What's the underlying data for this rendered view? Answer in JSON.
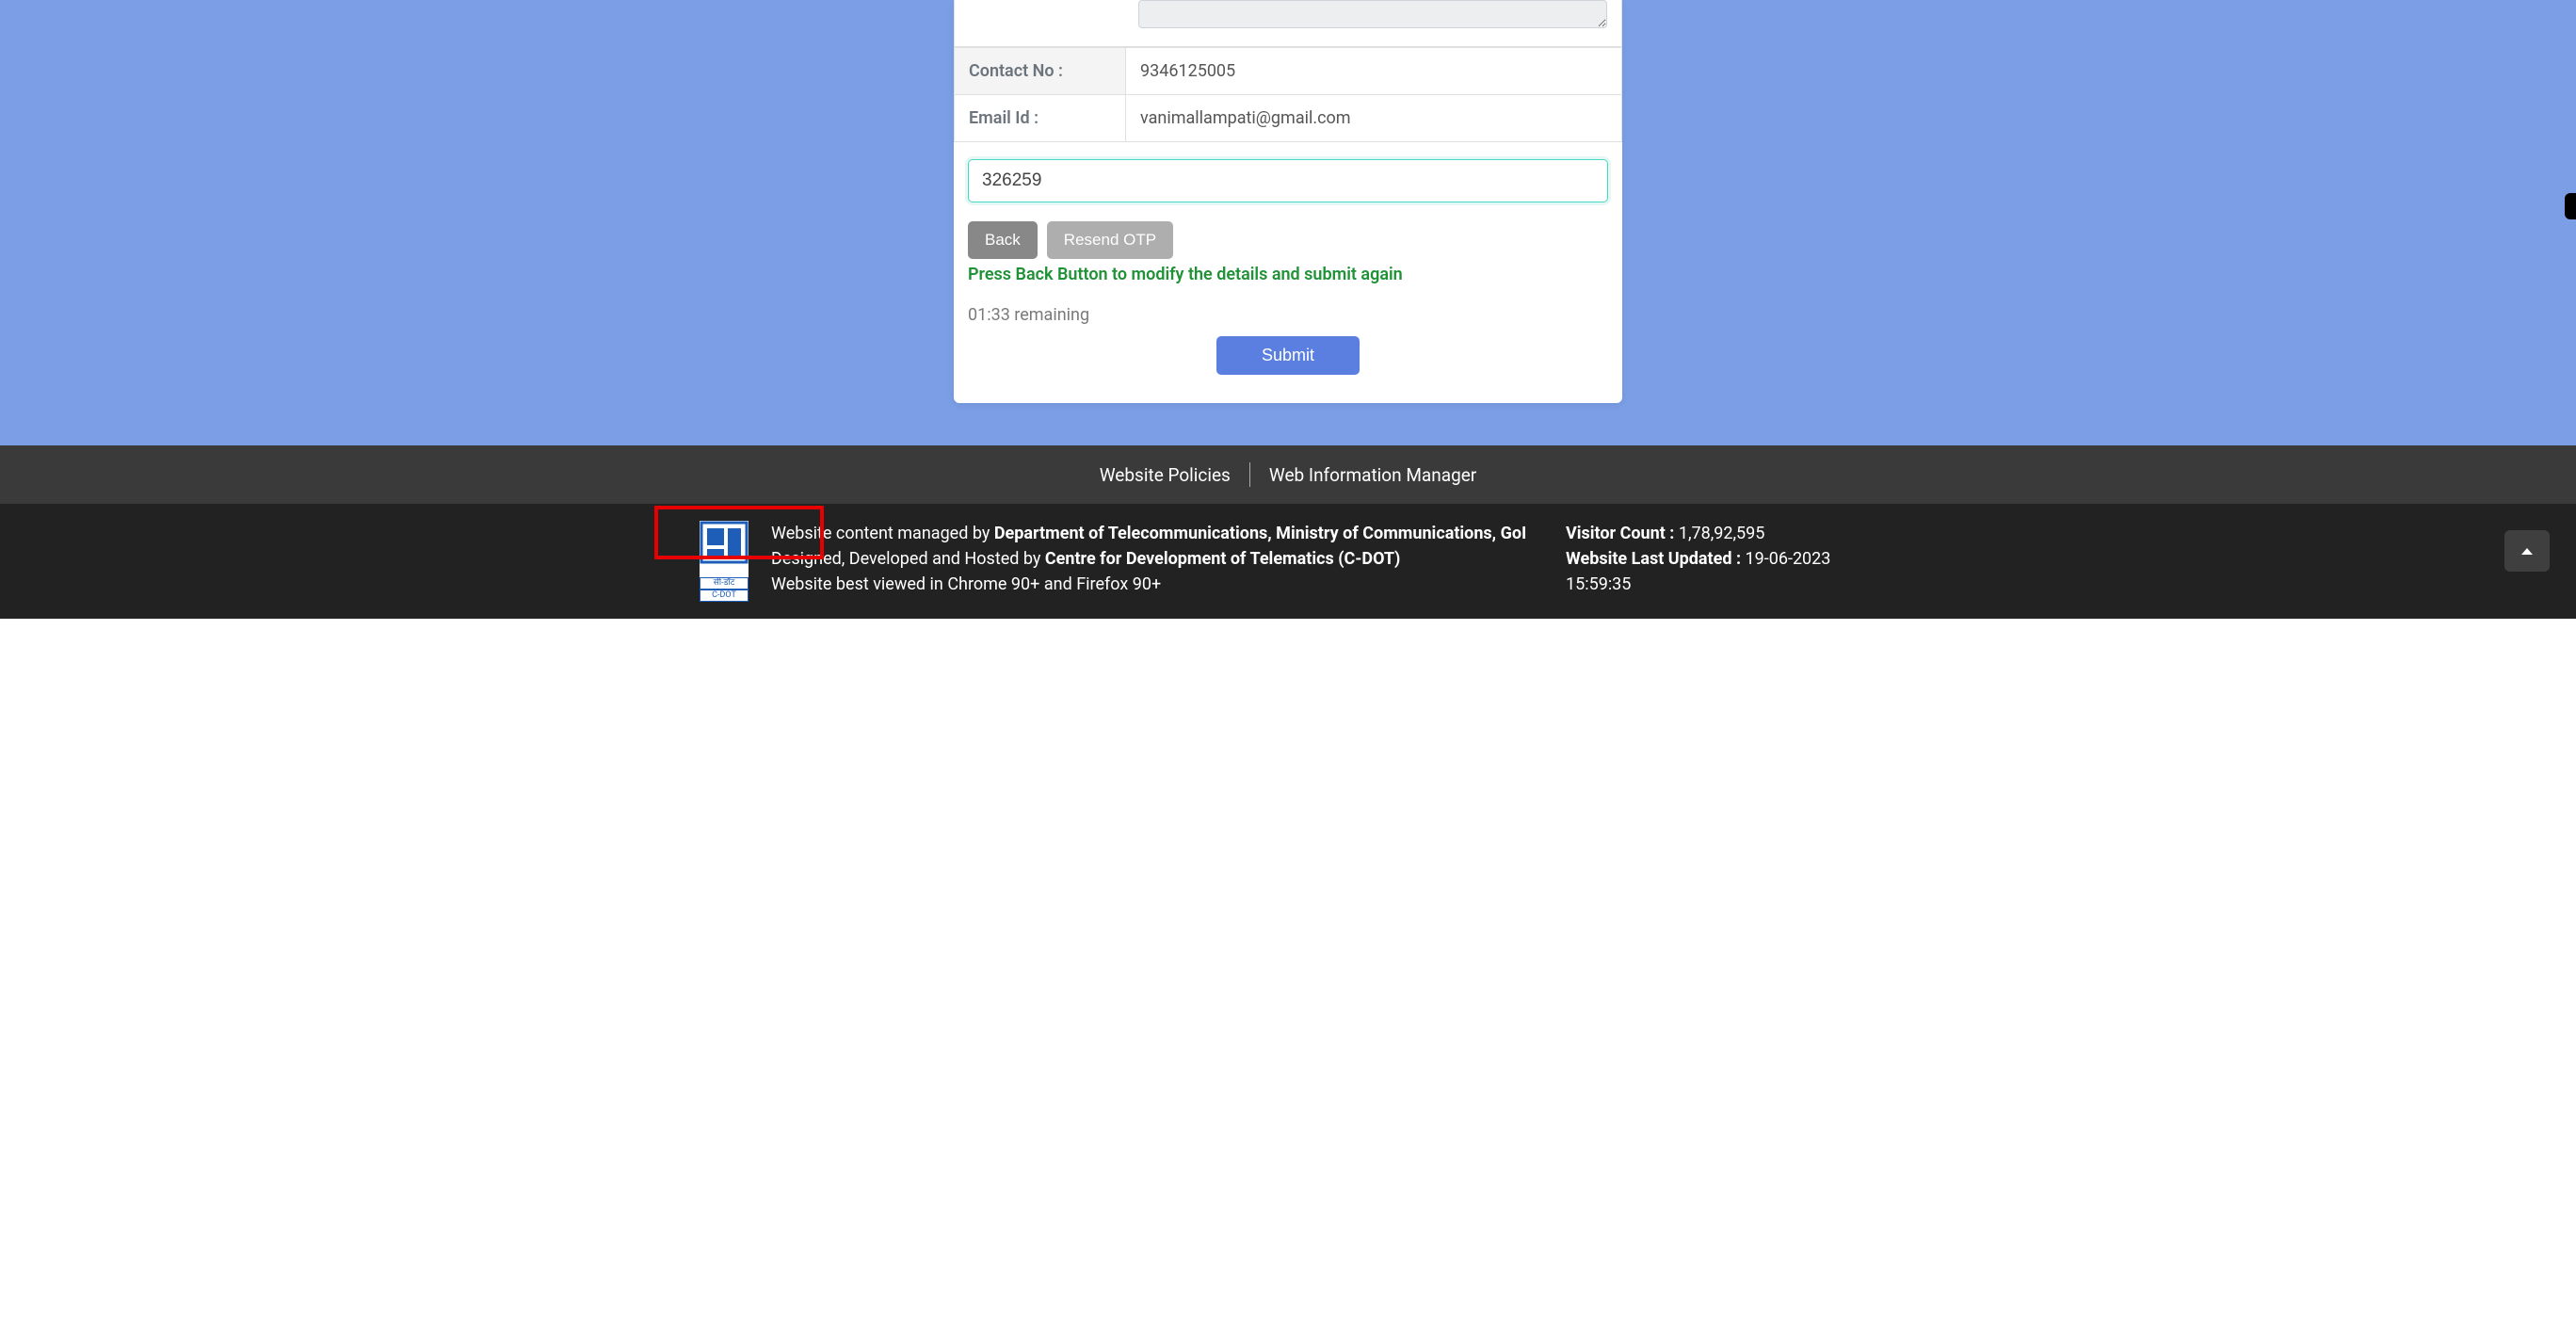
{
  "form": {
    "contact_label": "Contact No :",
    "contact_value": "9346125005",
    "email_label": "Email Id :",
    "email_value": "vanimallampati@gmail.com",
    "otp_value": "326259",
    "back_label": "Back",
    "resend_label": "Resend OTP",
    "hint": "Press Back Button to modify the details and submit again",
    "timer": "01:33 remaining",
    "submit_label": "Submit"
  },
  "footer": {
    "policies": "Website Policies",
    "wim": "Web Information Manager",
    "line1_prefix": "Website content managed by ",
    "line1_bold": "Department of Telecommunications, Ministry of Communications, GoI",
    "line2_prefix": "Designed, Developed and Hosted by ",
    "line2_bold": "Centre for Development of Telematics (C-DOT)",
    "line3": "Website best viewed in Chrome 90+ and Firefox 90+",
    "visitor_label": "Visitor Count : ",
    "visitor_value": "1,78,92,595",
    "updated_label": "Website Last Updated : ",
    "updated_value": "19-06-2023 15:59:35",
    "logo_text_hi": "सी-डॉट",
    "logo_text_en": "C-DOT"
  }
}
